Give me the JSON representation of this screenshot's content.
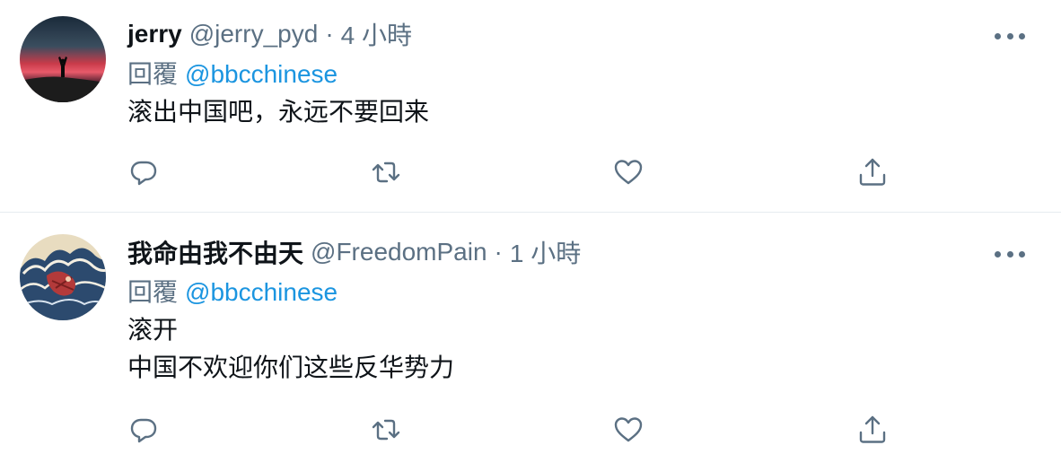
{
  "tweets": [
    {
      "display_name": "jerry",
      "handle": "@jerry_pyd",
      "separator": "·",
      "time": "4 小時",
      "reply_prefix": "回覆",
      "reply_to": "@bbcchinese",
      "text_lines": [
        "滚出中国吧，永远不要回来"
      ],
      "avatar": "sunset-silhouette"
    },
    {
      "display_name": "我命由我不由天",
      "handle": "@FreedomPain",
      "separator": "·",
      "time": "1 小時",
      "reply_prefix": "回覆",
      "reply_to": "@bbcchinese",
      "text_lines": [
        "滚开",
        "中国不欢迎你们这些反华势力"
      ],
      "avatar": "wave-painting"
    }
  ],
  "icons": {
    "more": "more-dots-icon",
    "reply": "reply-icon",
    "retweet": "retweet-icon",
    "like": "heart-icon",
    "share": "share-icon"
  },
  "colors": {
    "text": "#0f1419",
    "secondary": "#5b7083",
    "link": "#1b95e0",
    "divider": "#e6ecf0"
  }
}
